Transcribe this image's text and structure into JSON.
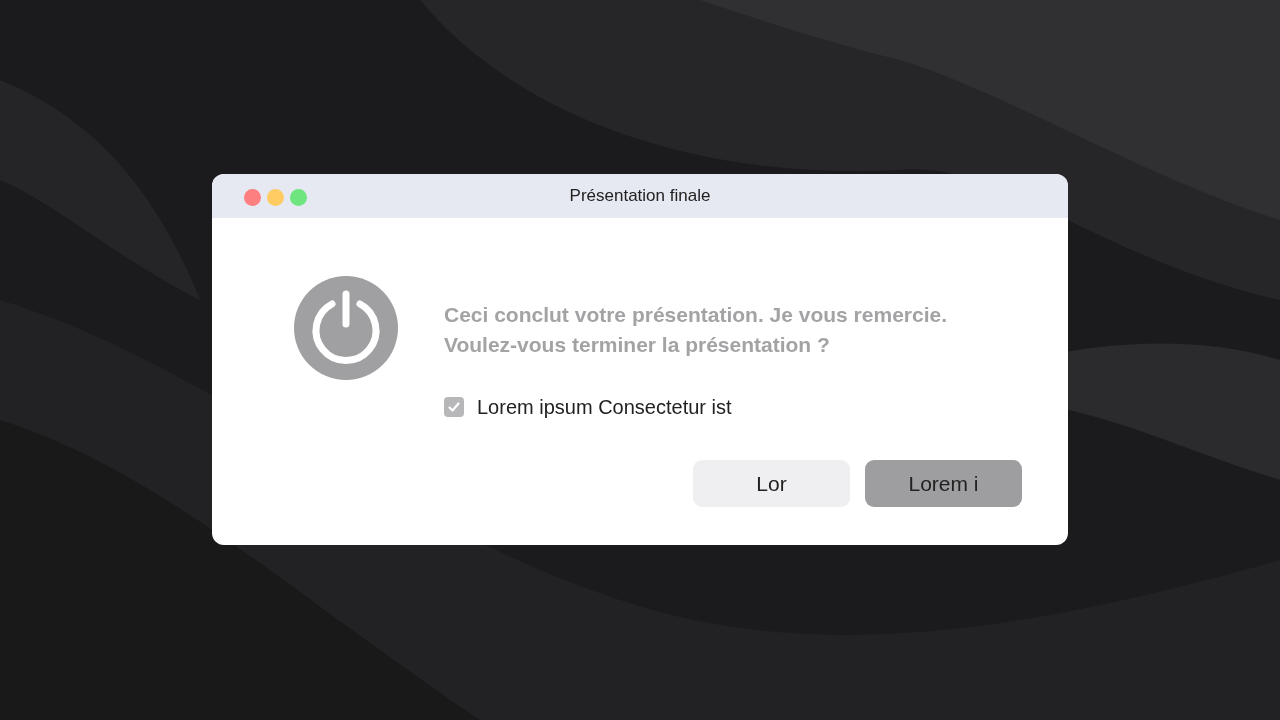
{
  "window": {
    "title": "Présentation finale",
    "traffic_lights": [
      {
        "color": "#fe7f7f"
      },
      {
        "color": "#ffcb63"
      },
      {
        "color": "#6ee57f"
      }
    ]
  },
  "message": "Ceci conclut votre présentation. Je vous remercie. Voulez-vous terminer la présentation ?",
  "checkbox": {
    "label": "Lorem ipsum Consectetur ist",
    "checked": true
  },
  "buttons": [
    {
      "label": "Lor",
      "kind": "secondary"
    },
    {
      "label": "Lorem i",
      "kind": "primary"
    }
  ]
}
